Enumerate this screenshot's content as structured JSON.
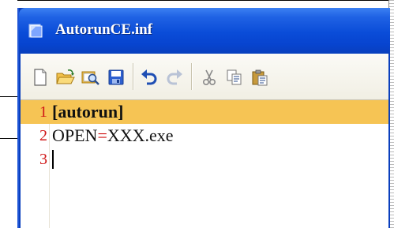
{
  "window": {
    "title": "AutorunCE.inf",
    "title_bar_color": "#0a4cd8"
  },
  "toolbar": {
    "buttons": [
      {
        "name": "new",
        "icon": "new-file-icon"
      },
      {
        "name": "open",
        "icon": "open-folder-icon"
      },
      {
        "name": "find",
        "icon": "find-icon"
      },
      {
        "name": "save",
        "icon": "save-icon"
      },
      {
        "name": "undo",
        "icon": "undo-icon"
      },
      {
        "name": "redo",
        "icon": "redo-icon"
      },
      {
        "name": "cut",
        "icon": "cut-icon"
      },
      {
        "name": "copy",
        "icon": "copy-icon"
      },
      {
        "name": "paste",
        "icon": "paste-icon"
      }
    ]
  },
  "editor": {
    "current_line_color": "#f6c454",
    "line_number_color": "#d01717",
    "lines": [
      {
        "number": "1",
        "text": "[autorun]"
      },
      {
        "number": "2",
        "key": "OPEN",
        "sep": "=",
        "value": "XXX.exe"
      },
      {
        "number": "3",
        "text": ""
      }
    ]
  }
}
